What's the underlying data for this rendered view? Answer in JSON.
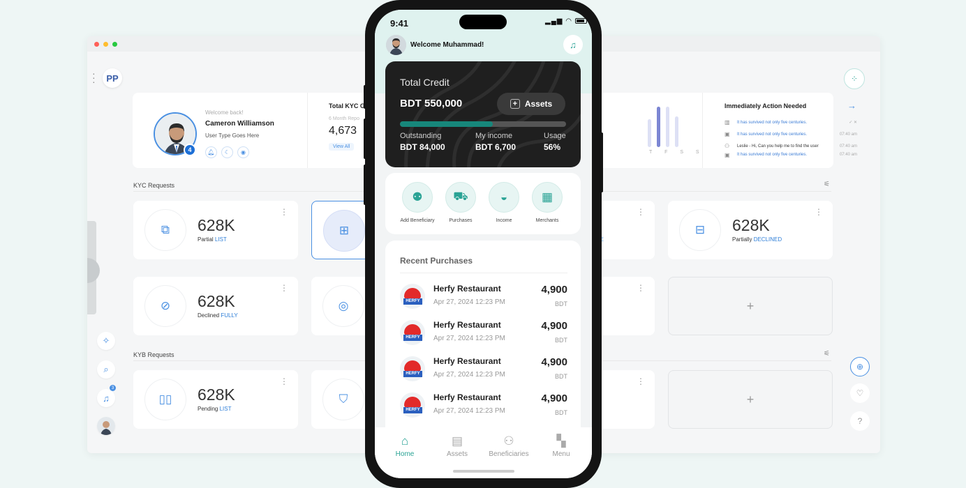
{
  "desktop": {
    "logo": "PP",
    "profile": {
      "welcome": "Welcome back!",
      "name": "Cameron Williamson",
      "user_type": "User Type Goes Here",
      "badge": "4"
    },
    "kyc_summary": {
      "title": "Total KYC G",
      "subtitle": "6 Month Repo",
      "value": "4,673",
      "link": "View All"
    },
    "chart": {
      "days": "T F S S"
    },
    "actions": {
      "title": "Immediately Action Needed",
      "items": [
        {
          "text": "It has survived not only five centuries.",
          "time": ""
        },
        {
          "text": "It has survived not only five centuries.",
          "time": "07:40 am"
        },
        {
          "text": "Leslie - Hi, Can you help me to find the user",
          "time": "07:40 am"
        },
        {
          "text": "It has survived not only five centuries.",
          "time": "07:40 am"
        }
      ]
    },
    "sections": {
      "kyc": "KYC Requests",
      "kyb": "KYB Requests"
    },
    "cards": [
      {
        "value": "628K",
        "label": "Partial",
        "tag": "LIST"
      },
      {
        "value": "628K",
        "label": "Partially",
        "tag": "DECLINED"
      },
      {
        "value": "628K",
        "label": "Declined",
        "tag": "FULLY"
      },
      {
        "value": "628K",
        "label": "Pending",
        "tag": "LIST"
      }
    ],
    "partial_tag": "VE",
    "add_symbol": "+",
    "notification_count": "3"
  },
  "phone": {
    "time": "9:41",
    "welcome": "Welcome Muhammad!",
    "credit": {
      "title": "Total Credit",
      "amount": "BDT 550,000",
      "assets_label": "Assets",
      "usage_fraction": 0.56,
      "stats": [
        {
          "label": "Outstanding",
          "value": "BDT 84,000"
        },
        {
          "label": "My income",
          "value": "BDT 6,700"
        },
        {
          "label": "Usage",
          "value": "56%"
        }
      ]
    },
    "quick_actions": [
      "Add Beneficiary",
      "Purchases",
      "Income",
      "Merchants"
    ],
    "recent": {
      "title": "Recent Purchases",
      "items": [
        {
          "name": "Herfy Restaurant",
          "date": "Apr 27, 2024 12:23 PM",
          "amount": "4,900",
          "currency": "BDT",
          "logo_text": "HERFY"
        },
        {
          "name": "Herfy Restaurant",
          "date": "Apr 27, 2024 12:23 PM",
          "amount": "4,900",
          "currency": "BDT",
          "logo_text": "HERFY"
        },
        {
          "name": "Herfy Restaurant",
          "date": "Apr 27, 2024 12:23 PM",
          "amount": "4,900",
          "currency": "BDT",
          "logo_text": "HERFY"
        },
        {
          "name": "Herfy Restaurant",
          "date": "Apr 27, 2024 12:23 PM",
          "amount": "4,900",
          "currency": "BDT",
          "logo_text": "HERFY"
        }
      ]
    },
    "tabs": [
      "Home",
      "Assets",
      "Beneficiaries",
      "Menu"
    ]
  }
}
